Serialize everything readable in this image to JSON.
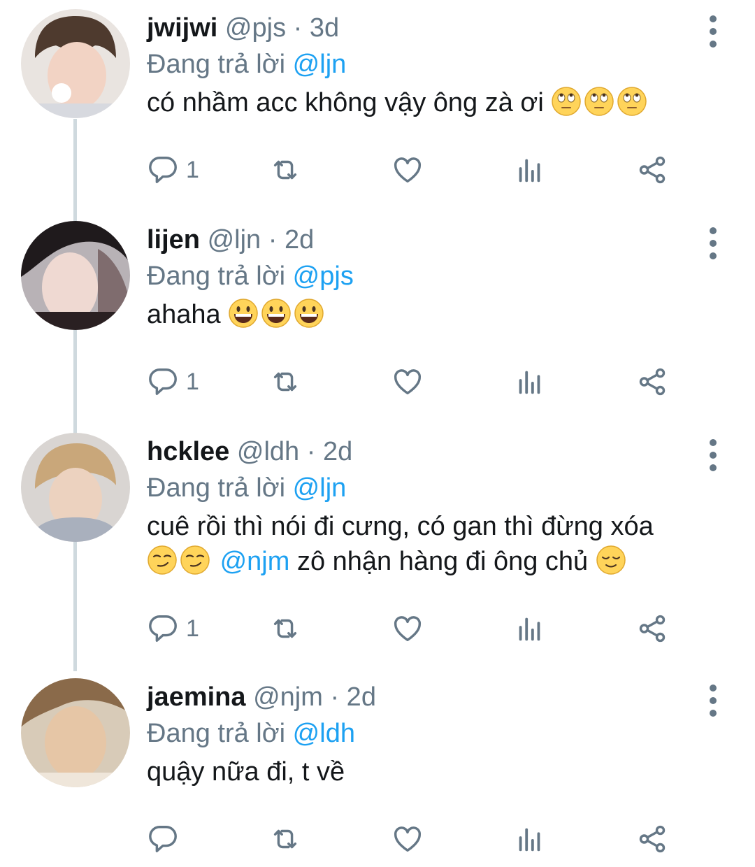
{
  "tweets": [
    {
      "name": "jwijwi",
      "handle": "@pjs",
      "time": "· 3d",
      "reply_label": "Đang trả lời",
      "reply_to": "@ljn",
      "text": "có nhầm acc không vậy ông zà ơi",
      "reply_count": "1",
      "emoji": "face-with-rolling-eyes"
    },
    {
      "name": "lijen",
      "handle": "@ljn",
      "time": "· 2d",
      "reply_label": "Đang trả lời",
      "reply_to": "@pjs",
      "text": "ahaha",
      "reply_count": "1",
      "emoji": "grinning-face"
    },
    {
      "name": "hcklee",
      "handle": "@ldh",
      "time": "· 2d",
      "reply_label": "Đang trả lời",
      "reply_to": "@ljn",
      "text_part1": "cuê rồi thì nói đi cưng, có gan thì đừng xóa",
      "mention": "@njm",
      "text_part2": "zô nhận hàng đi ông chủ",
      "reply_count": "1",
      "emoji": "smirking-face / relieved-face"
    },
    {
      "name": "jaemina",
      "handle": "@njm",
      "time": "· 2d",
      "reply_label": "Đang trả lời",
      "reply_to": "@ldh",
      "text": "quậy nữa đi, t về",
      "reply_count": ""
    }
  ],
  "colors": {
    "text": "#14171a",
    "secondary": "#657786",
    "link": "#1da1f2",
    "thread_line": "#cfd9de",
    "icon": "#657786"
  }
}
